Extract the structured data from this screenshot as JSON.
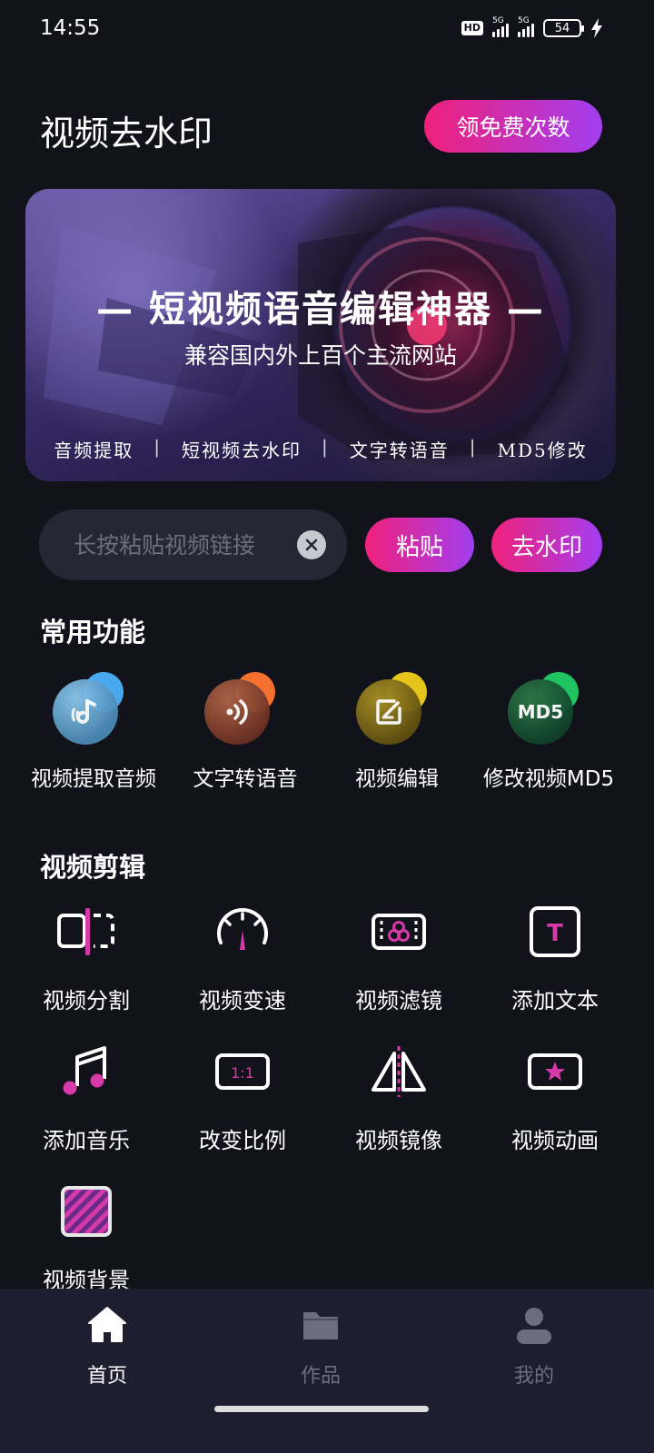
{
  "status_bar": {
    "time": "14:55",
    "hd": "HD",
    "net1": "5G",
    "net2": "5G",
    "battery": "54"
  },
  "header": {
    "title": "视频去水印",
    "free_button": "领免费次数"
  },
  "banner": {
    "title": "— 短视频语音编辑神器 —",
    "subtitle": "兼容国内外上百个主流网站",
    "tags": [
      "音频提取",
      "短视频去水印",
      "文字转语音",
      "MD5修改"
    ],
    "separator": "|"
  },
  "search": {
    "placeholder": "长按粘贴视频链接",
    "value": "",
    "paste_label": "粘贴",
    "remove_label": "去水印"
  },
  "common_functions": {
    "title": "常用功能",
    "items": [
      {
        "label": "视频提取音频",
        "icon": "music-note-icon",
        "color": "#5fb4f0"
      },
      {
        "label": "文字转语音",
        "icon": "sound-wave-icon",
        "color": "#f57b3a"
      },
      {
        "label": "视频编辑",
        "icon": "edit-icon",
        "color": "#e0c224"
      },
      {
        "label": "修改视频MD5",
        "icon": "md5-icon",
        "color": "#27c868",
        "icon_text": "MD5"
      }
    ]
  },
  "video_editing": {
    "title": "视频剪辑",
    "items": [
      {
        "label": "视频分割",
        "icon": "split-icon"
      },
      {
        "label": "视频变速",
        "icon": "speed-icon"
      },
      {
        "label": "视频滤镜",
        "icon": "filter-icon"
      },
      {
        "label": "添加文本",
        "icon": "text-icon",
        "icon_text": "T"
      },
      {
        "label": "添加音乐",
        "icon": "music-icon"
      },
      {
        "label": "改变比例",
        "icon": "ratio-icon",
        "icon_text": "1:1"
      },
      {
        "label": "视频镜像",
        "icon": "mirror-icon"
      },
      {
        "label": "视频动画",
        "icon": "animation-icon"
      },
      {
        "label": "视频背景",
        "icon": "background-icon"
      }
    ]
  },
  "bottom_nav": {
    "items": [
      {
        "label": "首页",
        "icon": "home-icon",
        "active": true
      },
      {
        "label": "作品",
        "icon": "folder-icon",
        "active": false
      },
      {
        "label": "我的",
        "icon": "profile-icon",
        "active": false
      }
    ],
    "active_color": "#ffffff",
    "inactive_color": "#6e6d7e"
  },
  "colors": {
    "accent_start": "#f0207a",
    "accent_end": "#a23ef0",
    "background": "#12131a"
  }
}
